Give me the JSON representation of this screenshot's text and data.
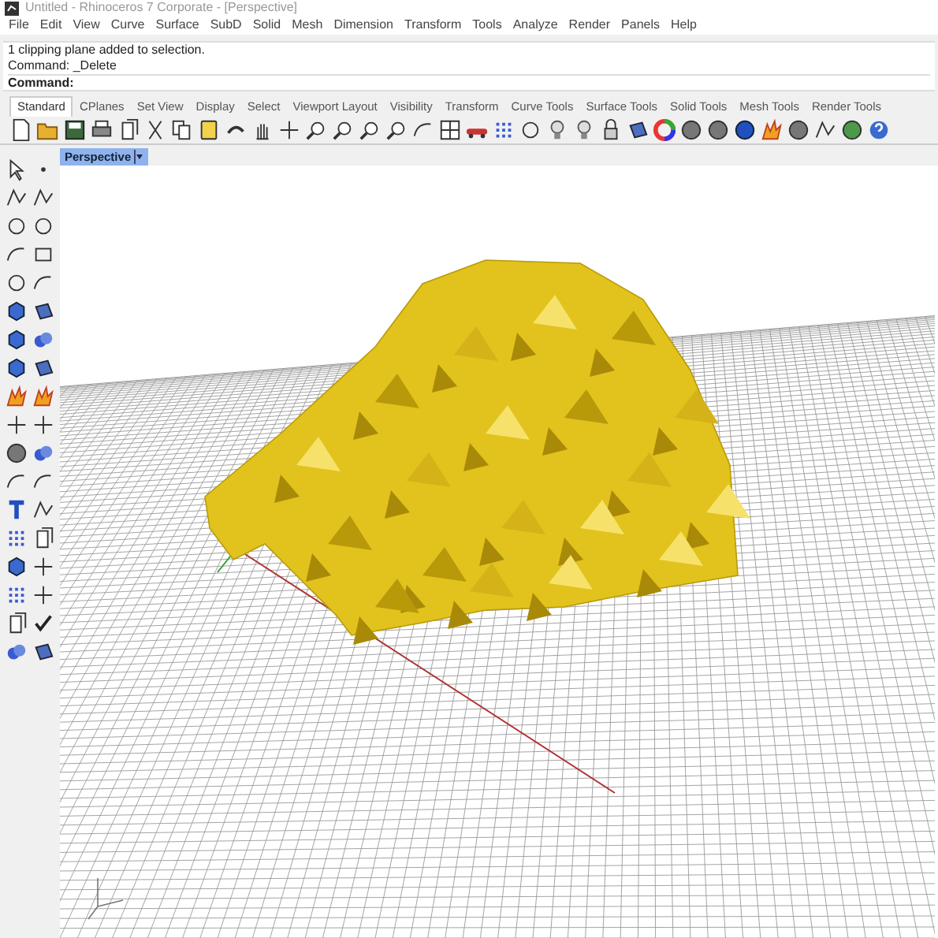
{
  "window": {
    "title": "Untitled - Rhinoceros 7 Corporate - [Perspective]"
  },
  "menu": [
    "File",
    "Edit",
    "View",
    "Curve",
    "Surface",
    "SubD",
    "Solid",
    "Mesh",
    "Dimension",
    "Transform",
    "Tools",
    "Analyze",
    "Render",
    "Panels",
    "Help"
  ],
  "command_history": [
    "1 clipping plane added to selection.",
    "Command: _Delete"
  ],
  "command_prompt": "Command:",
  "toolbar_tabs": [
    {
      "label": "Standard",
      "selected": true
    },
    {
      "label": "CPlanes",
      "selected": false
    },
    {
      "label": "Set View",
      "selected": false
    },
    {
      "label": "Display",
      "selected": false
    },
    {
      "label": "Select",
      "selected": false
    },
    {
      "label": "Viewport Layout",
      "selected": false
    },
    {
      "label": "Visibility",
      "selected": false
    },
    {
      "label": "Transform",
      "selected": false
    },
    {
      "label": "Curve Tools",
      "selected": false
    },
    {
      "label": "Surface Tools",
      "selected": false
    },
    {
      "label": "Solid Tools",
      "selected": false
    },
    {
      "label": "Mesh Tools",
      "selected": false
    },
    {
      "label": "Render Tools",
      "selected": false
    }
  ],
  "viewport": {
    "tab": "Perspective"
  }
}
